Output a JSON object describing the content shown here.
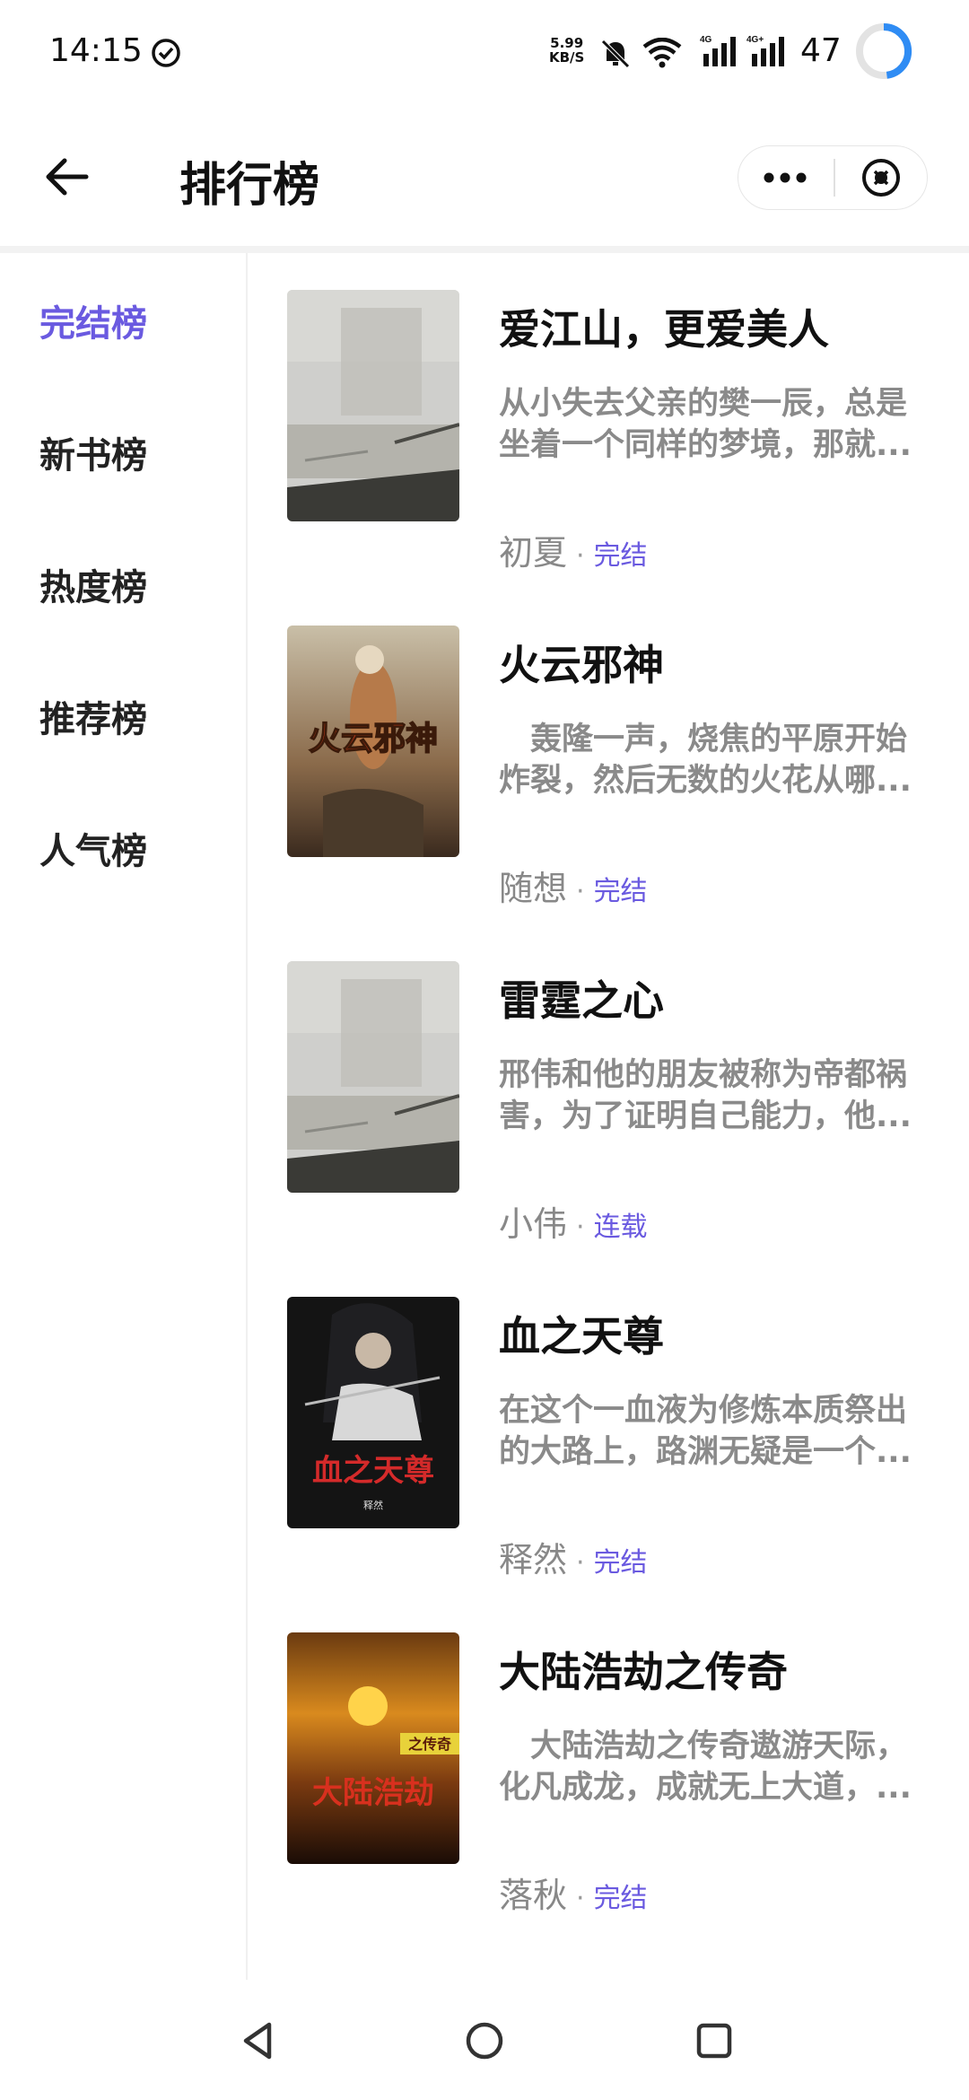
{
  "status_bar": {
    "time": "14:15",
    "speed_value": "5.99",
    "speed_unit": "KB/S",
    "net1": "4G",
    "net2": "4G+",
    "battery": "47"
  },
  "header": {
    "title": "排行榜",
    "back_icon": "arrow-left-icon",
    "more_icon": "more-dots-icon",
    "close_icon": "close-circle-icon"
  },
  "sidebar": {
    "items": [
      {
        "label": "完结榜",
        "active": true
      },
      {
        "label": "新书榜",
        "active": false
      },
      {
        "label": "热度榜",
        "active": false
      },
      {
        "label": "推荐榜",
        "active": false
      },
      {
        "label": "人气榜",
        "active": false
      }
    ]
  },
  "books": [
    {
      "title": "爱江山，更爱美人",
      "desc1": "从小失去父亲的樊一辰，总是",
      "desc2": "坐着一个同样的梦境，那就...",
      "author": "初夏",
      "status": "完结"
    },
    {
      "title": "火云邪神",
      "desc1": "　轰隆一声，烧焦的平原开始",
      "desc2": "炸裂，然后无数的火花从哪...",
      "author": "随想",
      "status": "完结",
      "cover_text": "火云邪神"
    },
    {
      "title": "雷霆之心",
      "desc1": "邢伟和他的朋友被称为帝都祸",
      "desc2": "害，为了证明自己能力，他...",
      "author": "小伟",
      "status": "连载"
    },
    {
      "title": "血之天尊",
      "desc1": "在这个一血液为修炼本质祭出",
      "desc2": "的大路上，路渊无疑是一个...",
      "author": "释然",
      "status": "完结",
      "cover_text": "血之天尊",
      "cover_author": "释然"
    },
    {
      "title": "大陆浩劫之传奇",
      "desc1": "　大陆浩劫之传奇遨游天际，",
      "desc2": "化凡成龙，成就无上大道，...",
      "author": "落秋",
      "status": "完结",
      "cover_text": "大陆浩劫",
      "cover_subtitle": "之传奇"
    }
  ],
  "nav_bar": {
    "back_icon": "triangle-back-icon",
    "home_icon": "circle-home-icon",
    "recent_icon": "square-recents-icon"
  },
  "colors": {
    "accent": "#6a5ae0",
    "text_primary": "#111111",
    "text_secondary": "#8a8a8a"
  }
}
